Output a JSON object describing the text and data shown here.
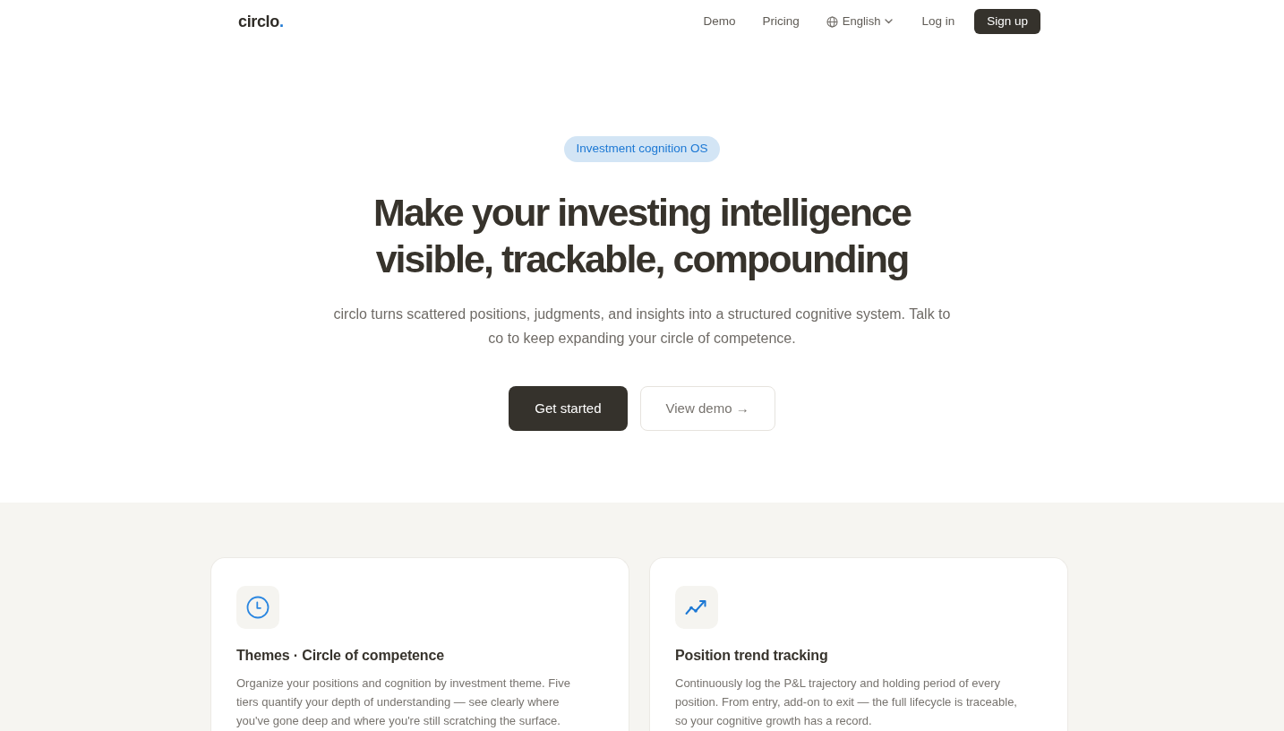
{
  "nav": {
    "logo": {
      "name": "circlo",
      "mark": "."
    },
    "links": [
      "Demo",
      "Pricing"
    ],
    "language": {
      "label": "English"
    },
    "login": "Log in",
    "signup": "Sign up"
  },
  "hero": {
    "badge": "Investment cognition OS",
    "heading_lines": [
      "Make your investing intelligence",
      "visible, trackable, compounding"
    ],
    "description": "circlo turns scattered positions, judgments, and insights into a structured cognitive system. Talk to co to keep expanding your circle of competence.",
    "buttons": [
      {
        "label": "Get started",
        "kind": "primary"
      },
      {
        "label": "View demo →",
        "kind": "secondary"
      }
    ]
  },
  "features": [
    {
      "kind": "clock",
      "title": "Themes · Circle of competence",
      "description": "Organize your positions and cognition by investment theme. Five tiers quantify your depth of understanding — see clearly where you've gone deep and where you're still scratching the surface."
    },
    {
      "kind": "trend",
      "title": "Position trend tracking",
      "description": "Continuously log the P&L trajectory and holding period of every position. From entry, add-on to exit — the full lifecycle is traceable, so your cognitive growth has a record."
    }
  ]
}
